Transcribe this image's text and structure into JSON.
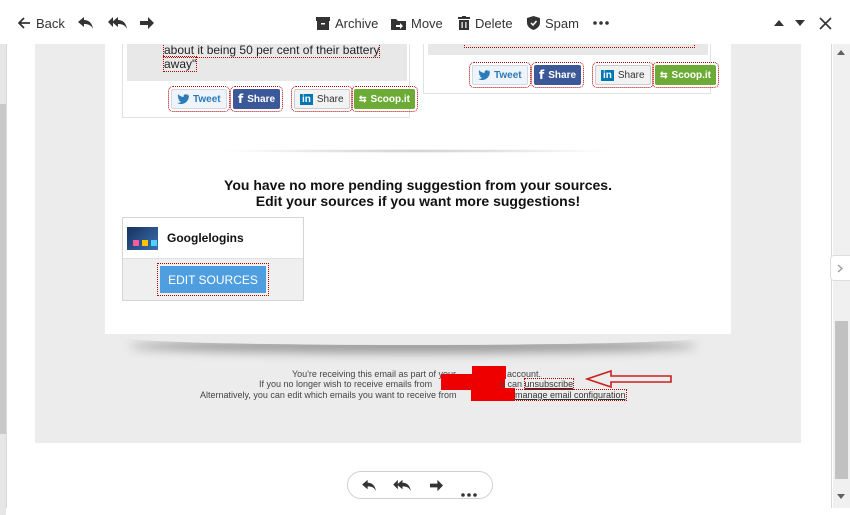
{
  "toolbar": {
    "back_label": "Back",
    "archive_label": "Archive",
    "move_label": "Move",
    "delete_label": "Delete",
    "spam_label": "Spam"
  },
  "articles": {
    "left_quote_line1": "about it being 50 per cent of their battery",
    "left_quote_line2": "away\""
  },
  "share_buttons": {
    "tweet": "Tweet",
    "facebook": "Share",
    "linkedin": "Share",
    "scoopit": "Scoop.it"
  },
  "pending": {
    "line1": "You have no more pending suggestion from your sources.",
    "line2": "Edit your sources if you want more suggestions!"
  },
  "source": {
    "name": "Googlelogins",
    "edit_button": "EDIT SOURCES"
  },
  "footer": {
    "line1_start": "You're receiving this email as part of your",
    "line1_end": "account.",
    "line2_start": "If you no longer wish to receive emails from",
    "line2_mid": "u can",
    "unsubscribe": "unsubscribe",
    "line3_start": "Alternatively, you can edit which emails you want to receive from",
    "manage_link": "manage email configuration"
  },
  "colors": {
    "accent_button": "#4f9fe0",
    "redaction": "#ee0000",
    "annotation_arrow": "#cc1f1f"
  }
}
